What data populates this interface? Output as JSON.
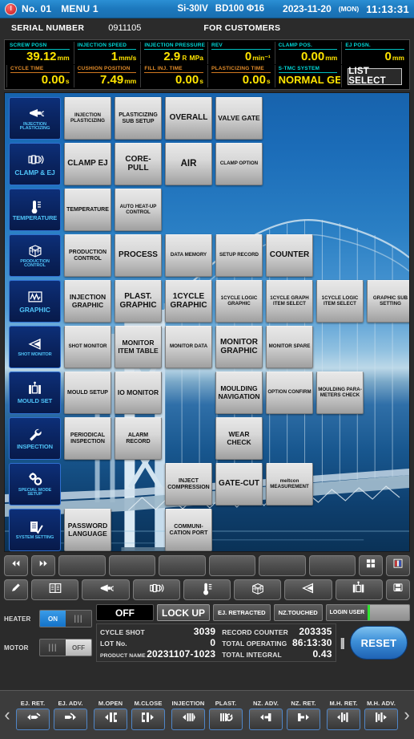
{
  "titlebar": {
    "machine_no": "No. 01",
    "menu": "MENU 1",
    "model": "Si-30IV",
    "spec": "BD100 Φ16",
    "date": "2023-11-20",
    "dow": "(MON)",
    "time": "11:13:31"
  },
  "serialbar": {
    "label": "SERIAL NUMBER",
    "value": "0911105",
    "for_customers": "FOR CUSTOMERS"
  },
  "datapanel": {
    "row1": [
      {
        "label": "SCREW POSN",
        "value": "39.12",
        "unit": "mm",
        "prefix": ""
      },
      {
        "label": "INJECTION SPEED",
        "value": "1",
        "unit": "mm/s",
        "prefix": ""
      },
      {
        "label": "INJECTION PRESSURE",
        "value": "2.9",
        "unit": "MPa",
        "prefix": "R"
      },
      {
        "label": "REV",
        "value": "0",
        "unit": "min⁻¹",
        "prefix": ""
      },
      {
        "label": "CLAMP POS.",
        "value": "0.00",
        "unit": "mm",
        "prefix": ""
      },
      {
        "label": "EJ POSN.",
        "value": "0",
        "unit": "mm",
        "prefix": ""
      }
    ],
    "row2": [
      {
        "label": "CYCLE TIME",
        "value": "0.00",
        "unit": "s",
        "prefix": ""
      },
      {
        "label": "CUSHION POSITION",
        "value": "7.49",
        "unit": "mm",
        "prefix": ""
      },
      {
        "label": "FILL INJ. TIME",
        "value": "0.00",
        "unit": "s",
        "prefix": ""
      },
      {
        "label": "PLASTICIZING TIME",
        "value": "0.00",
        "unit": "s",
        "prefix": ""
      }
    ],
    "stmc": {
      "label": "S-TMC SYSTEM",
      "value": "NORMAL GEAR"
    },
    "list_select": "LIST SELECT"
  },
  "sidebar": [
    {
      "label": "INJECTION\nPLASTICIZING",
      "icon": "injection-nozzle-icon",
      "size": "sm",
      "row": 1
    },
    {
      "label": "CLAMP & EJ",
      "icon": "clamp-eject-icon",
      "size": "lg",
      "row": 2
    },
    {
      "label": "TEMPERATURE",
      "icon": "thermometer-icon",
      "size": "md",
      "row": 3
    },
    {
      "label": "PRODUCTION\nCONTROL",
      "icon": "cube-grid-icon",
      "size": "sm",
      "row": 4
    },
    {
      "label": "GRAPHIC",
      "icon": "waveform-icon",
      "size": "lg",
      "row": 5
    },
    {
      "label": "SHOT MONITOR",
      "icon": "shot-cone-icon",
      "size": "sm",
      "row": 6
    },
    {
      "label": "MOULD SET",
      "icon": "mould-icon",
      "size": "md",
      "row": 7
    },
    {
      "label": "INSPECTION",
      "icon": "wrench-icon",
      "size": "md",
      "row": 8
    },
    {
      "label": "SPECIAL MODE\nSETUP",
      "icon": "gears-icon",
      "size": "sm",
      "row": 9
    },
    {
      "label": "SYSTEM SETTING",
      "icon": "document-check-icon",
      "size": "sm",
      "row": 10
    }
  ],
  "grid_buttons": [
    {
      "label": "INJECTION\nPLASTICIZING",
      "row": 1,
      "col": 1,
      "size": "xs"
    },
    {
      "label": "PLASTICIZING\nSUB SETUP",
      "row": 1,
      "col": 2,
      "size": "sm"
    },
    {
      "label": "OVERALL",
      "row": 1,
      "col": 3,
      "size": "lg"
    },
    {
      "label": "VALVE GATE",
      "row": 1,
      "col": 4,
      "size": "md"
    },
    {
      "label": "CLAMP  EJ",
      "row": 2,
      "col": 1,
      "size": "lg"
    },
    {
      "label": "CORE-PULL",
      "row": 2,
      "col": 2,
      "size": "lg"
    },
    {
      "label": "AIR",
      "row": 2,
      "col": 3,
      "size": "xl"
    },
    {
      "label": "CLAMP OPTION",
      "row": 2,
      "col": 4,
      "size": "xs"
    },
    {
      "label": "TEMPERATURE",
      "row": 3,
      "col": 1,
      "size": "sm"
    },
    {
      "label": "AUTO HEAT-UP\nCONTROL",
      "row": 3,
      "col": 2,
      "size": "xs"
    },
    {
      "label": "PRODUCTION\nCONTROL",
      "row": 4,
      "col": 1,
      "size": "sm"
    },
    {
      "label": "PROCESS",
      "row": 4,
      "col": 2,
      "size": "lg"
    },
    {
      "label": "DATA MEMORY",
      "row": 4,
      "col": 3,
      "size": "xs"
    },
    {
      "label": "SETUP RECORD",
      "row": 4,
      "col": 4,
      "size": "xs"
    },
    {
      "label": "COUNTER",
      "row": 4,
      "col": 5,
      "size": "lg"
    },
    {
      "label": "INJECTION\nGRAPHIC",
      "row": 5,
      "col": 1,
      "size": "md"
    },
    {
      "label": "PLAST.\nGRAPHIC",
      "row": 5,
      "col": 2,
      "size": "lg"
    },
    {
      "label": "1CYCLE\nGRAPHIC",
      "row": 5,
      "col": 3,
      "size": "lg"
    },
    {
      "label": "1CYCLE LOGIC\nGRAPHIC",
      "row": 5,
      "col": 4,
      "size": "xs"
    },
    {
      "label": "1CYCLE GRAPH\nITEM SELECT",
      "row": 5,
      "col": 5,
      "size": "xs"
    },
    {
      "label": "1CYCLE LOGIC\nITEM SELECT",
      "row": 5,
      "col": 6,
      "size": "xs"
    },
    {
      "label": "GRAPHIC SUB\nSETTING",
      "row": 5,
      "col": 7,
      "size": "xs"
    },
    {
      "label": "SHOT MONITOR",
      "row": 6,
      "col": 1,
      "size": "xs"
    },
    {
      "label": "MONITOR\nITEM TABLE",
      "row": 6,
      "col": 2,
      "size": "md"
    },
    {
      "label": "MONITOR DATA",
      "row": 6,
      "col": 3,
      "size": "xs"
    },
    {
      "label": "MONITOR\nGRAPHIC",
      "row": 6,
      "col": 4,
      "size": "lg"
    },
    {
      "label": "MONITOR SPARE",
      "row": 6,
      "col": 5,
      "size": "xs"
    },
    {
      "label": "MOULD SETUP",
      "row": 7,
      "col": 1,
      "size": "sm"
    },
    {
      "label": "IO MONITOR",
      "row": 7,
      "col": 2,
      "size": "md"
    },
    {
      "label": "MOULDING\nNAVIGATION",
      "row": 7,
      "col": 4,
      "size": "md"
    },
    {
      "label": "OPTION CONFIRM",
      "row": 7,
      "col": 5,
      "size": "xs"
    },
    {
      "label": "MOULDING PARA-\nMETERS CHECK",
      "row": 7,
      "col": 6,
      "size": "xs"
    },
    {
      "label": "PERIODICAL\nINSPECTION",
      "row": 8,
      "col": 1,
      "size": "sm"
    },
    {
      "label": "ALARM RECORD",
      "row": 8,
      "col": 2,
      "size": "sm"
    },
    {
      "label": "WEAR CHECK",
      "row": 8,
      "col": 4,
      "size": "md"
    },
    {
      "label": "INJECT\nCOMPRESSION",
      "row": 9,
      "col": 3,
      "size": "sm"
    },
    {
      "label": "GATE-CUT",
      "row": 9,
      "col": 4,
      "size": "lg"
    },
    {
      "label": "meltcon\nMEASUREMENT",
      "row": 9,
      "col": 5,
      "size": "xs"
    },
    {
      "label": "PASSWORD\nLANGUAGE",
      "row": 10,
      "col": 1,
      "size": "md"
    },
    {
      "label": "COMMUNI-\nCATION PORT",
      "row": 10,
      "col": 3,
      "size": "sm"
    }
  ],
  "toolbar_row1": [
    {
      "icon": "rewind-icon",
      "kind": "small"
    },
    {
      "icon": "fast-forward-icon",
      "kind": "small"
    },
    {
      "icon": "blank-icon",
      "kind": "wide"
    },
    {
      "icon": "blank-icon",
      "kind": "wide"
    },
    {
      "icon": "blank-icon",
      "kind": "wide"
    },
    {
      "icon": "blank-icon",
      "kind": "wide"
    },
    {
      "icon": "blank-icon",
      "kind": "wide"
    },
    {
      "icon": "blank-icon",
      "kind": "wide"
    },
    {
      "icon": "grid-tiles-icon",
      "kind": "small"
    },
    {
      "icon": "color-panel-icon",
      "kind": "small"
    }
  ],
  "toolbar_row2": [
    {
      "icon": "pencil-icon",
      "kind": "small"
    },
    {
      "icon": "book-icon",
      "kind": "wide"
    },
    {
      "icon": "injection-nozzle-icon",
      "kind": "wide"
    },
    {
      "icon": "clamp-eject-icon",
      "kind": "wide"
    },
    {
      "icon": "thermometer-icon",
      "kind": "wide"
    },
    {
      "icon": "cube-grid-icon",
      "kind": "wide"
    },
    {
      "icon": "shot-cone-icon",
      "kind": "wide"
    },
    {
      "icon": "mould-icon",
      "kind": "wide"
    },
    {
      "icon": "save-disk-icon",
      "kind": "small"
    }
  ],
  "status": {
    "heater": {
      "label": "HEATER",
      "on_text": "ON",
      "state": "ON"
    },
    "motor": {
      "label": "MOTOR",
      "off_text": "OFF",
      "state": "OFF"
    },
    "mode_off": "OFF",
    "lock_up": "LOCK UP",
    "ej_retracted": "EJ. RETRACTED",
    "nz_touched": "NZ.TOUCHED",
    "login_user_label": "LOGIN USER",
    "counters_left": [
      {
        "label": "CYCLE SHOT",
        "value": "3039",
        "tiny": false
      },
      {
        "label": "LOT No.",
        "value": "0",
        "tiny": false
      },
      {
        "label": "PRODUCT NAME",
        "value": "20231107-1023",
        "tiny": true
      }
    ],
    "counters_right": [
      {
        "label": "RECORD COUNTER",
        "value": "203335"
      },
      {
        "label": "TOTAL OPERATING",
        "value": "86:13:30"
      },
      {
        "label": "TOTAL INTEGRAL",
        "value": "0.43"
      }
    ],
    "reset": "RESET"
  },
  "bottom_controls": [
    {
      "label": "EJ. RET.",
      "icon": "ej-retract-icon",
      "group": 1
    },
    {
      "label": "EJ. ADV.",
      "icon": "ej-advance-icon",
      "group": 1
    },
    {
      "label": "M.OPEN",
      "icon": "mould-open-icon",
      "group": 2
    },
    {
      "label": "M.CLOSE",
      "icon": "mould-close-icon",
      "group": 2
    },
    {
      "label": "INJECTION",
      "icon": "injection-icon",
      "group": 3
    },
    {
      "label": "PLAST.",
      "icon": "plasticizing-icon",
      "group": 3
    },
    {
      "label": "NZ. ADV.",
      "icon": "nozzle-advance-icon",
      "group": 4
    },
    {
      "label": "NZ. RET.",
      "icon": "nozzle-retract-icon",
      "group": 4
    },
    {
      "label": "M.H. RET.",
      "icon": "mould-height-retract-icon",
      "group": 5
    },
    {
      "label": "M.H. ADV.",
      "icon": "mould-height-advance-icon",
      "group": 5
    }
  ]
}
